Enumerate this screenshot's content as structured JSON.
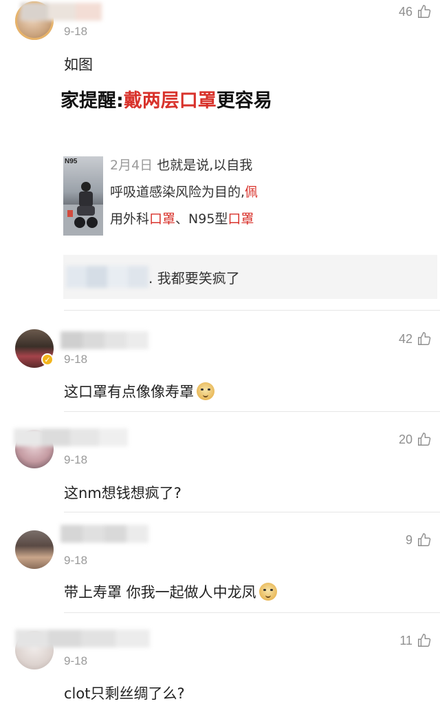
{
  "comments": [
    {
      "date": "9-18",
      "likes": "46",
      "text": "如图",
      "shared": {
        "headline_prefix": "家提醒:",
        "headline_red": "戴两层口罩",
        "headline_suffix": "更容易",
        "thumb_tag": "N95",
        "line1_date": "2月4日",
        "line1_rest": " 也就是说,以自我",
        "line2_black": "呼吸道感染风险为目的,",
        "line2_red": "佩",
        "line3_a": "用外科",
        "line3_red1": "口罩",
        "line3_b": "、N95型",
        "line3_red2": "口罩"
      },
      "reply_text": ". 我都要笑疯了"
    },
    {
      "date": "9-18",
      "likes": "42",
      "text": "这口罩有点像像寿罩",
      "emoji": "doge-emoji",
      "verified": true
    },
    {
      "date": "9-18",
      "likes": "20",
      "text": "这nm想钱想疯了?"
    },
    {
      "date": "9-18",
      "likes": "9",
      "text": "带上寿罩 你我一起做人中龙凤",
      "emoji": "doge-emoji"
    },
    {
      "date": "9-18",
      "likes": "11",
      "text": "clot只剩丝绸了么?"
    }
  ],
  "icons": {
    "like": "thumbs-up-icon",
    "verified": "verified-badge-icon"
  },
  "colors": {
    "accent_red": "#d8322b",
    "meta_gray": "#9a9a9a",
    "verified_gold": "#f3b51c"
  }
}
